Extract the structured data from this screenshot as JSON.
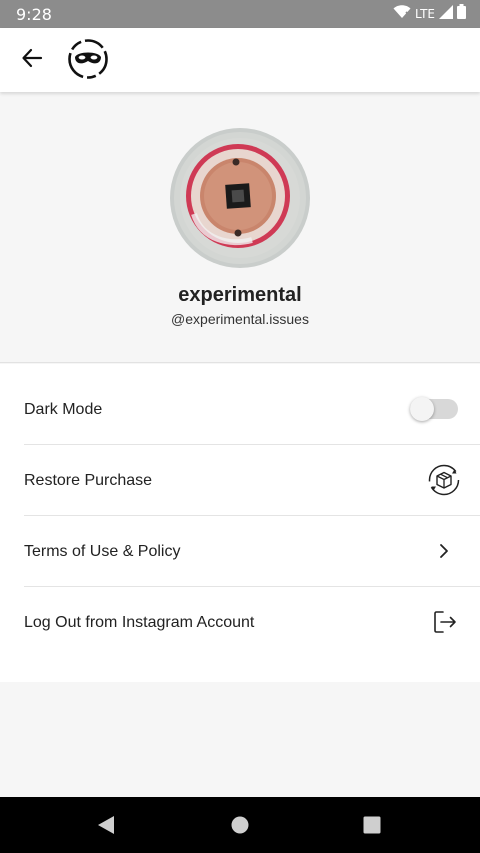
{
  "status_bar": {
    "time": "9:28",
    "network": "LTE",
    "icons": [
      "wifi-icon",
      "signal-icon",
      "battery-icon"
    ]
  },
  "app_bar": {
    "back_icon": "arrow-left-icon",
    "logo_icon": "masked-face-logo"
  },
  "profile": {
    "display_name": "experimental",
    "username": "@experimental.issues"
  },
  "settings": {
    "dark_mode": {
      "label": "Dark Mode",
      "enabled": false
    },
    "restore_purchase": {
      "label": "Restore Purchase",
      "icon": "restore-box-icon"
    },
    "terms": {
      "label": "Terms of Use & Policy",
      "icon": "chevron-right-icon"
    },
    "logout": {
      "label": "Log Out from Instagram Account",
      "icon": "logout-icon"
    }
  },
  "nav_bar": {
    "buttons": [
      "back-triangle-icon",
      "home-circle-icon",
      "recents-square-icon"
    ]
  },
  "colors": {
    "status_bar": "#8c8c8c",
    "page_background": "#f6f6f6",
    "surface": "#ffffff",
    "nav_bar": "#000000",
    "avatar_ring": "#c22a45"
  }
}
